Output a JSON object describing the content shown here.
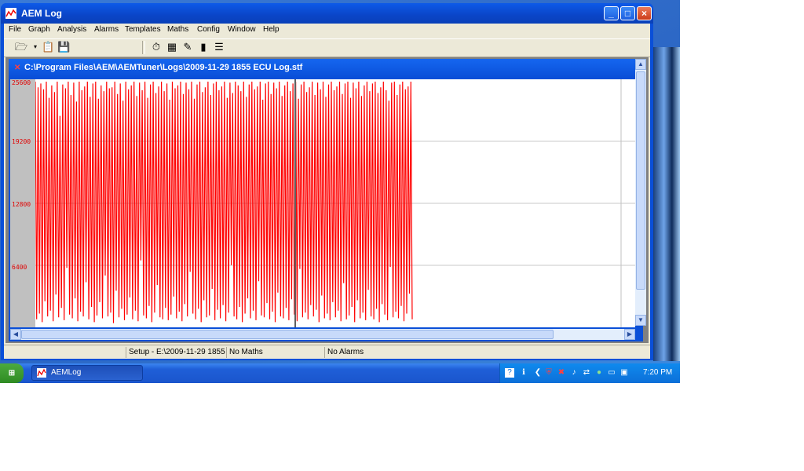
{
  "window": {
    "title": "AEM Log"
  },
  "menu": [
    "File",
    "Graph",
    "Analysis",
    "Alarms",
    "Templates",
    "Maths",
    "Config",
    "Window",
    "Help"
  ],
  "child": {
    "title": "C:\\Program Files\\AEM\\AEMTuner\\Logs\\2009-11-29 1855 ECU Log.stf"
  },
  "chart_data": {
    "type": "line",
    "yticks": [
      "25600",
      "19200",
      "12800",
      "6400"
    ],
    "ylim": [
      0,
      25600
    ],
    "series": [
      {
        "color": "#ff0000",
        "values": [
          25600,
          600,
          25000,
          1200,
          25400,
          300,
          24800,
          2500,
          25600,
          900,
          23900,
          1500,
          25200,
          400,
          24500,
          3200,
          25600,
          800,
          22000,
          1800,
          25300,
          500,
          24900,
          6000,
          25600,
          1100,
          24200,
          700,
          25500,
          2800,
          23500,
          400,
          25600,
          1400,
          24700,
          900,
          25100,
          4500,
          25600,
          600,
          24000,
          1900,
          25400,
          300,
          25600,
          1000,
          23800,
          2400,
          25200,
          700,
          24600,
          5200,
          25600,
          900,
          24900,
          1300,
          25000,
          200,
          25600,
          3600,
          24300,
          800,
          25400,
          1700,
          23600,
          500,
          25600,
          1100,
          24800,
          2900,
          25200,
          600,
          25600,
          1500,
          24100,
          400,
          25500,
          6800,
          24700,
          1000,
          25600,
          700,
          23900,
          2000,
          25300,
          300,
          25600,
          1300,
          24400,
          4200,
          25100,
          800,
          25600,
          600,
          24600,
          1800,
          25400,
          500,
          23700,
          1100,
          25600,
          3000,
          24900,
          700,
          25200,
          1400,
          25600,
          400,
          24300,
          2200,
          25500,
          900,
          24800,
          5600,
          25600,
          1200,
          23800,
          600,
          25300,
          1700,
          25600,
          300,
          24500,
          2600,
          25000,
          800,
          25600,
          1000,
          24200,
          3800,
          25400,
          500,
          25600,
          1600,
          24700,
          700,
          25100,
          2100,
          25600,
          400,
          23900,
          1300,
          25500,
          6300,
          24400,
          900,
          25600,
          600,
          25200,
          1900,
          24600,
          300,
          25600,
          1200,
          24000,
          2800,
          25300,
          700,
          25600,
          1500,
          24800,
          500,
          25100,
          4600,
          25600,
          1000,
          23700,
          800,
          25400,
          2300,
          25600,
          600,
          24300,
          1400,
          25500,
          300,
          24900,
          3400,
          25600,
          900,
          24100,
          700,
          25200,
          1800,
          25600,
          500,
          24600,
          2700,
          25400,
          1100,
          25600,
          400,
          23800,
          5900,
          25300,
          800,
          25600,
          1300,
          24500,
          600,
          25000,
          2100,
          25600,
          900,
          24200,
          1600,
          25500,
          300,
          24800,
          3100,
          25600,
          700,
          24000,
          1200,
          25300,
          500,
          25600,
          2400,
          24700,
          800,
          25100,
          1500,
          25600,
          400,
          24300,
          4400,
          25400,
          600,
          25600,
          1000,
          23900,
          1900,
          25500,
          300,
          24900,
          2600,
          25600,
          700,
          24100,
          1300,
          25200,
          500,
          25600,
          3700,
          24600,
          900,
          25400,
          600,
          25600,
          1700,
          24400,
          300,
          25000,
          2200,
          25600,
          1100,
          24700,
          500,
          23600,
          6100,
          25500,
          800,
          25600,
          1400,
          24200,
          700,
          25300,
          2000,
          25600,
          400,
          24800,
          1200,
          25100,
          3300,
          25600,
          600
        ]
      }
    ]
  },
  "status": {
    "setup": "Setup - E:\\2009-11-29 1855",
    "maths": "No Maths",
    "alarms": "No Alarms"
  },
  "taskbar": {
    "start": "start",
    "item": "AEMLog",
    "clock": "7:20 PM"
  }
}
